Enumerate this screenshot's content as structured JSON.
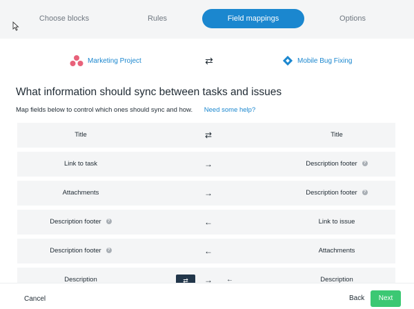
{
  "steps": [
    {
      "label": "Choose blocks"
    },
    {
      "label": "Rules"
    },
    {
      "label": "Field mappings",
      "active": true
    },
    {
      "label": "Options"
    }
  ],
  "projects": {
    "left": {
      "name": "Marketing Project",
      "icon": "asana-logo-icon",
      "color": "#e8627a"
    },
    "right": {
      "name": "Mobile Bug Fixing",
      "icon": "jira-logo-icon",
      "color": "#1b87cf"
    },
    "sync_icon": "⇄"
  },
  "heading": "What information should sync between tasks and issues",
  "subtext": "Map fields below to control which ones should sync and how.",
  "help_link": "Need some help?",
  "mappings": [
    {
      "left": "Title",
      "direction": "⇄",
      "right": "Title",
      "left_help": false,
      "right_help": false
    },
    {
      "left": "Link to task",
      "direction": "→",
      "right": "Description footer",
      "left_help": false,
      "right_help": true
    },
    {
      "left": "Attachments",
      "direction": "→",
      "right": "Description footer",
      "left_help": false,
      "right_help": true
    },
    {
      "left": "Description footer",
      "direction": "←",
      "right": "Link to issue",
      "left_help": true,
      "right_help": false
    },
    {
      "left": "Description footer",
      "direction": "←",
      "right": "Attachments",
      "left_help": true,
      "right_help": false
    },
    {
      "left": "Description",
      "direction": "→",
      "direction_alt": "←",
      "direction_selected": "⇄",
      "right": "Description",
      "left_help": false,
      "right_help": false
    }
  ],
  "help_glyph": "?",
  "footer": {
    "cancel": "Cancel",
    "back": "Back",
    "next": "Next",
    "next_color": "#3cc873"
  },
  "accent_color": "#1b87cf"
}
